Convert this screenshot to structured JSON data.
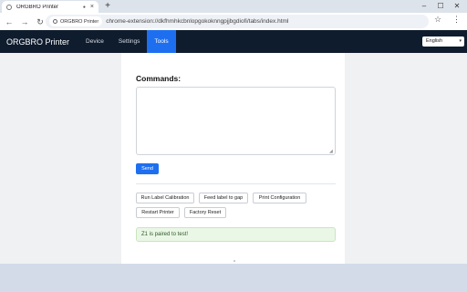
{
  "browser": {
    "tab_title": "ORGBRO Printer",
    "new_tab": "+",
    "back": "←",
    "forward": "→",
    "reload": "↻",
    "site_chip": "ORGBRO Printer",
    "url": "chrome-extension://dkfhmhkcbnlopgokoknngpjjbgdiofi/tabs/index.html",
    "star": "☆",
    "menu": "⋮",
    "minimize": "–",
    "maximize": "☐",
    "close": "✕"
  },
  "app": {
    "brand": "ORGBRO Printer",
    "nav": [
      "Device",
      "Settings",
      "Tools"
    ],
    "active_nav": "Tools",
    "language": "English"
  },
  "tools": {
    "commands_label": "Commands:",
    "commands_value": "",
    "send_label": "Send",
    "actions": [
      "Run Label Calibration",
      "Feed label to gap",
      "Print Configuration",
      "Restart Printer",
      "Factory Reset"
    ],
    "status": "Z1 is paired to test!"
  },
  "colors": {
    "header_bg": "#0f1c2e",
    "accent": "#1e6ff0",
    "success_bg": "#eaf7e6"
  }
}
